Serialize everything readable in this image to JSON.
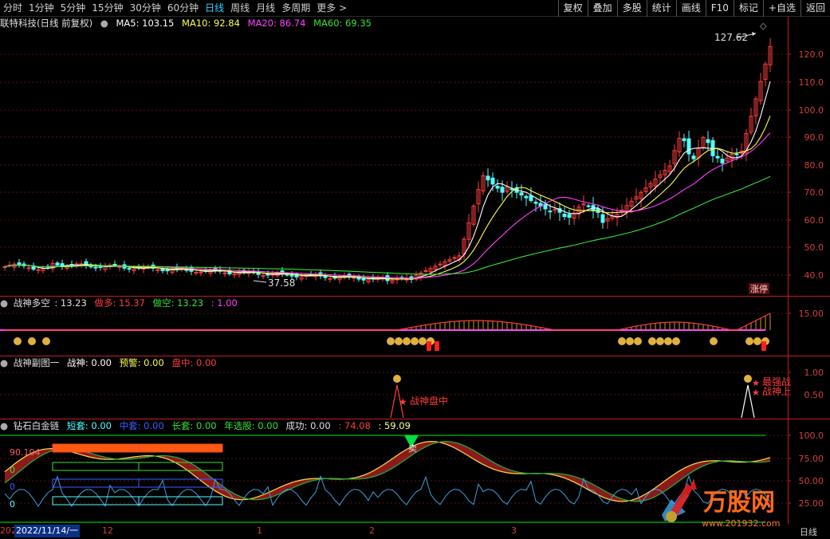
{
  "toolbar": {
    "periods": [
      "分时",
      "1分钟",
      "5分钟",
      "15分钟",
      "30分钟",
      "60分钟",
      "日线",
      "周线",
      "月线",
      "多周期",
      "更多 >"
    ],
    "active_period": "日线",
    "buttons": [
      "复权",
      "叠加",
      "多股",
      "统计",
      "画线",
      "F10",
      "标记",
      "+自选",
      "返回"
    ]
  },
  "main_pane": {
    "title": "联特科技(日线 前复权)",
    "ma5": "MA5: 103.15",
    "ma10": "MA10: 92.84",
    "ma20": "MA20: 86.74",
    "ma60": "MA60: 69.35",
    "high_label": "127.62",
    "low_label": "37.58",
    "badge": "涨停",
    "y_axis": [
      "120.0",
      "110.0",
      "100.0",
      "90.0",
      "80.0",
      "70.0",
      "60.0",
      "50.0",
      "40.0"
    ]
  },
  "pane2": {
    "name": "战神多空",
    "value": ": 13.23",
    "duo": "做多: 15.37",
    "kong": "做空: 13.23",
    "extra": ": 1.00",
    "y_axis": [
      "15.00"
    ]
  },
  "pane3": {
    "name": "战神副图一",
    "zhanshen": "战神: 0.00",
    "yujing": "预警: 0.00",
    "panzhong": "盘中: 0.00",
    "y_axis": [
      "1.00",
      "0.50"
    ],
    "annot_left": "战神盘中",
    "annot_right_1": "最强战",
    "annot_right_2": "战神上"
  },
  "pane4": {
    "name": "钻石白金链",
    "duantao": "短套: 0.00",
    "zhongtao": "中套: 0.00",
    "changtao": "长套: 0.00",
    "nianxuangu": "年选股: 0.00",
    "chenggong": "成功: 0.00",
    "v1": ": 74.08",
    "v2": ": 59.09",
    "left_value": "90.104",
    "left_zero_1": "0",
    "left_zero_2": "0",
    "left_zero_3": "0",
    "sell_label": "卖",
    "y_axis": [
      "100.0",
      "75.00",
      "50.00",
      "25.00"
    ]
  },
  "datebar": {
    "left": "202",
    "cursor_date": "2022/11/14/一",
    "ticks": [
      "12",
      "1",
      "2",
      "3"
    ],
    "period": "日线"
  },
  "watermark": {
    "brand": "万股网",
    "url": "www.201932.com"
  },
  "colors": {
    "up": "#ff3c3c",
    "down": "#54ffff",
    "ma5": "#ffffff",
    "ma10": "#ffff4f",
    "ma20": "#ff40ff",
    "ma60": "#38e038",
    "axis": "#d03030"
  }
}
